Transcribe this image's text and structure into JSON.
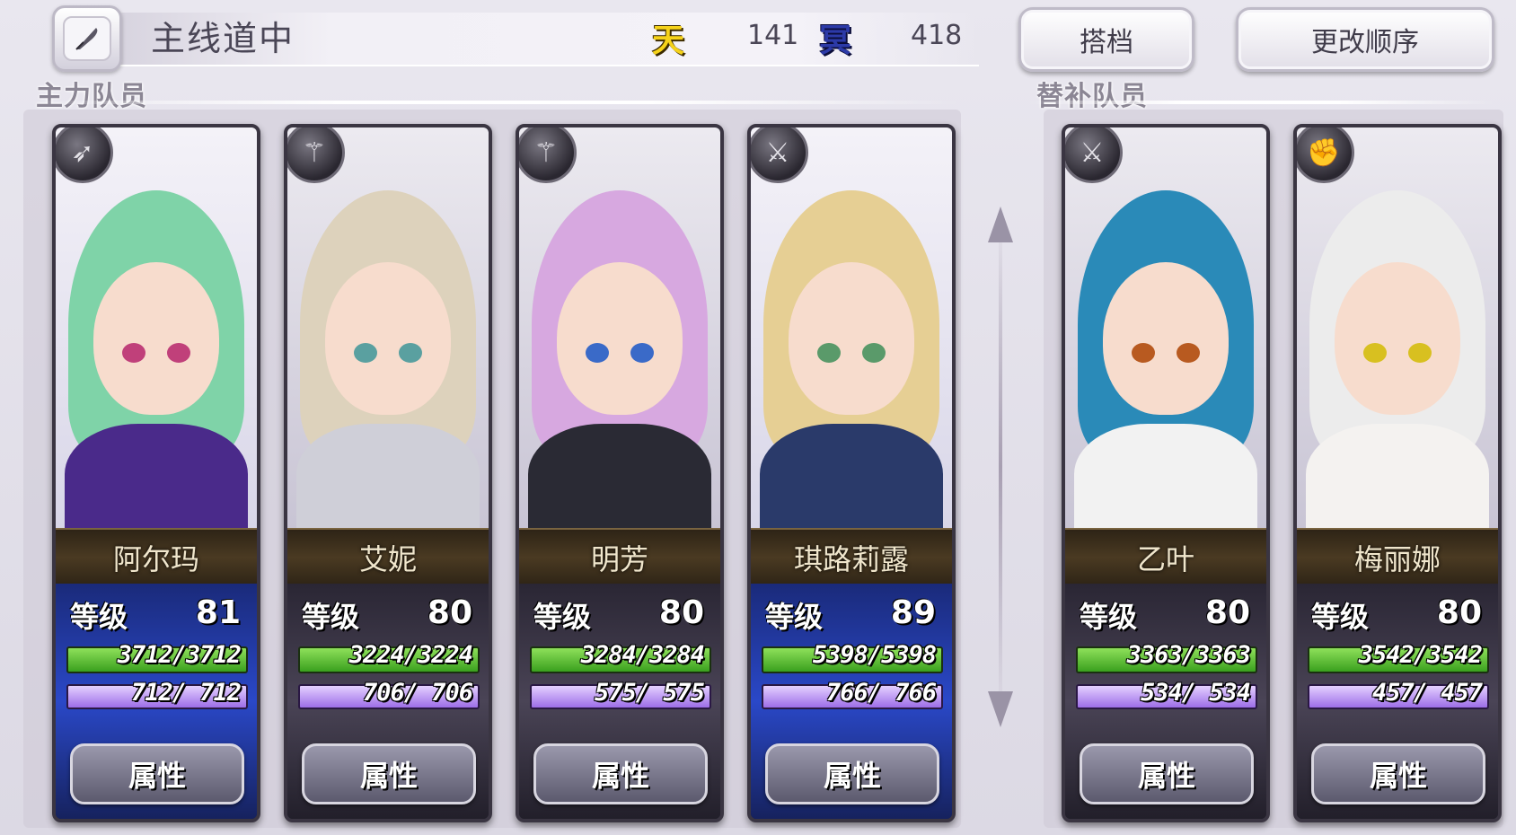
{
  "header": {
    "title": "主线道中",
    "resources": [
      {
        "icon": "天",
        "value": "141"
      },
      {
        "icon": "冥",
        "value": "418"
      }
    ],
    "buttons": {
      "partner": "搭档",
      "reorder": "更改顺序"
    }
  },
  "sections": {
    "main": "主力队员",
    "reserve": "替补队员"
  },
  "labels": {
    "level": "等级",
    "attributes": "属性"
  },
  "members": [
    {
      "name": "阿尔玛",
      "class_icon": "bow-icon",
      "level": "81",
      "hp": "3712/3712",
      "mp": "712/ 712",
      "theme": "blue",
      "hair": "#7fd3a8",
      "eye": "#c0407a",
      "outfit": "#4a2a8a"
    },
    {
      "name": "艾妮",
      "class_icon": "staff-icon",
      "level": "80",
      "hp": "3224/3224",
      "mp": "706/ 706",
      "theme": "dark",
      "hair": "#ddd2bc",
      "eye": "#5aa0a0",
      "outfit": "#cfcfd8"
    },
    {
      "name": "明芳",
      "class_icon": "staff-icon",
      "level": "80",
      "hp": "3284/3284",
      "mp": "575/ 575",
      "theme": "dark",
      "hair": "#d7a8e0",
      "eye": "#3a6ac8",
      "outfit": "#2a2a34"
    },
    {
      "name": "琪路莉露",
      "class_icon": "sword-icon",
      "level": "89",
      "hp": "5398/5398",
      "mp": "766/ 766",
      "theme": "blue",
      "hair": "#e6cf94",
      "eye": "#5a9a6a",
      "outfit": "#2a3a6a"
    },
    {
      "name": "乙叶",
      "class_icon": "katana-icon",
      "level": "80",
      "hp": "3363/3363",
      "mp": "534/ 534",
      "theme": "dark",
      "hair": "#2a8ab8",
      "eye": "#b85a20",
      "outfit": "#f2f2f2"
    },
    {
      "name": "梅丽娜",
      "class_icon": "fist-icon",
      "level": "80",
      "hp": "3542/3542",
      "mp": "457/ 457",
      "theme": "dark",
      "hair": "#ececec",
      "eye": "#d8c020",
      "outfit": "#f4f2f0"
    }
  ]
}
